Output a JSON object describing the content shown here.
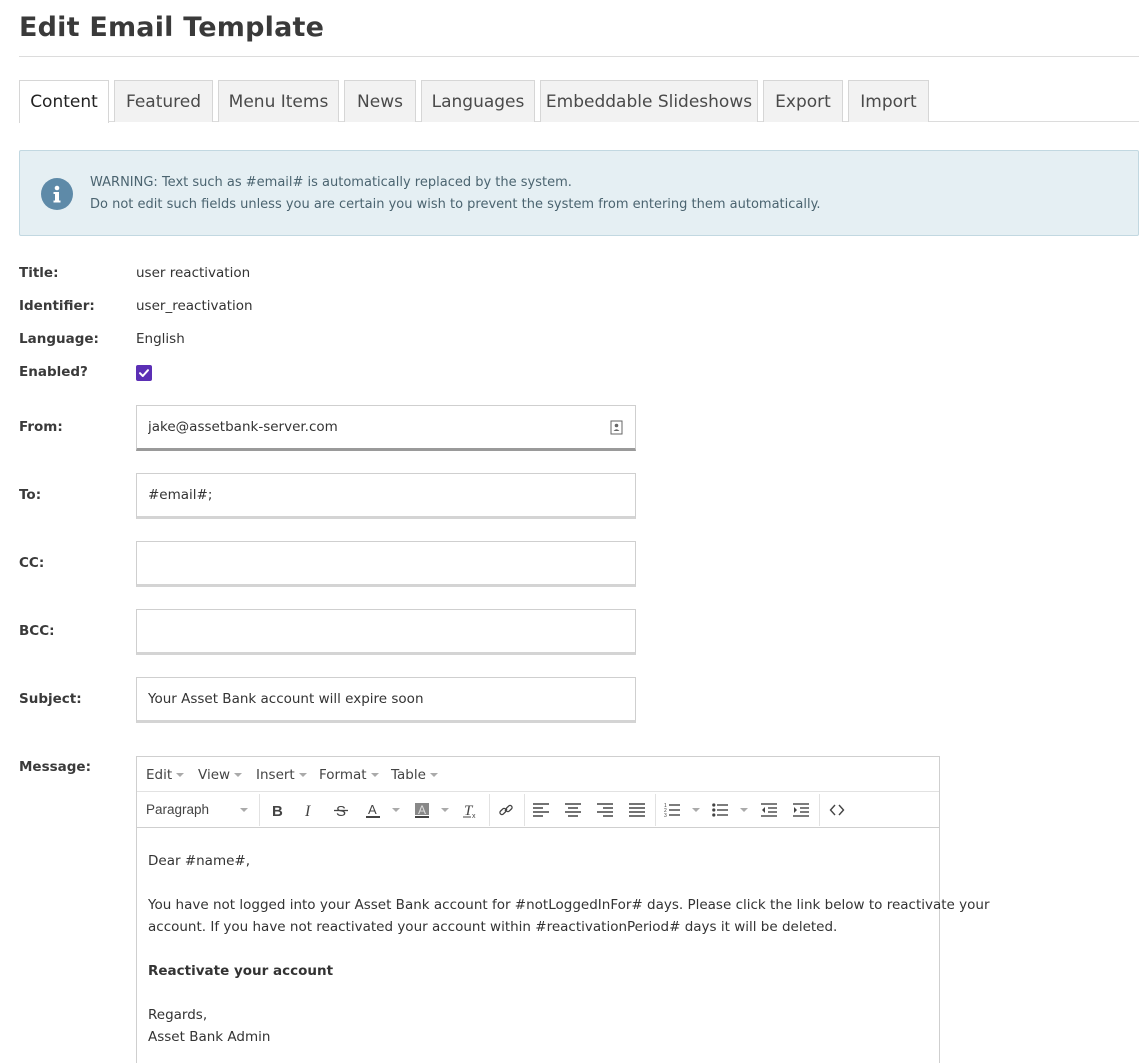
{
  "page": {
    "title": "Edit Email Template"
  },
  "tabs": [
    {
      "label": "Content",
      "active": true
    },
    {
      "label": "Featured",
      "active": false
    },
    {
      "label": "Menu Items",
      "active": false
    },
    {
      "label": "News",
      "active": false
    },
    {
      "label": "Languages",
      "active": false
    },
    {
      "label": "Embeddable Slideshows",
      "active": false
    },
    {
      "label": "Export",
      "active": false
    },
    {
      "label": "Import",
      "active": false
    }
  ],
  "alert": {
    "icon": "info-icon",
    "line1": "WARNING: Text such as #email# is automatically replaced by the system.",
    "line2": "Do not edit such fields unless you are certain you wish to prevent the system from entering them automatically."
  },
  "fields": {
    "title_label": "Title:",
    "title_value": "user reactivation",
    "identifier_label": "Identifier:",
    "identifier_value": "user_reactivation",
    "language_label": "Language:",
    "language_value": "English",
    "enabled_label": "Enabled?",
    "enabled_checked": true,
    "from_label": "From:",
    "from_value": "jake@assetbank-server.com",
    "to_label": "To:",
    "to_value": "#email#;",
    "cc_label": "CC:",
    "cc_value": "",
    "bcc_label": "BCC:",
    "bcc_value": "",
    "subject_label": "Subject:",
    "subject_value": "Your Asset Bank account will expire soon",
    "message_label": "Message:"
  },
  "editor": {
    "menu": [
      "Edit",
      "View",
      "Insert",
      "Format",
      "Table"
    ],
    "block_format": "Paragraph",
    "body": {
      "greeting": "Dear #name#,",
      "para_line1": "You have not logged into your Asset Bank account for #notLoggedInFor# days. Please click the link below to reactivate your",
      "para_line2": "account. If you have not reactivated your account within #reactivationPeriod# days it will be deleted.",
      "link": "Reactivate your account",
      "closing": "Regards,",
      "signature": "Asset Bank Admin"
    }
  },
  "colors": {
    "accent": "#5b2fb5",
    "alert_bg": "#e5eff3",
    "alert_icon": "#5e8aa8"
  }
}
